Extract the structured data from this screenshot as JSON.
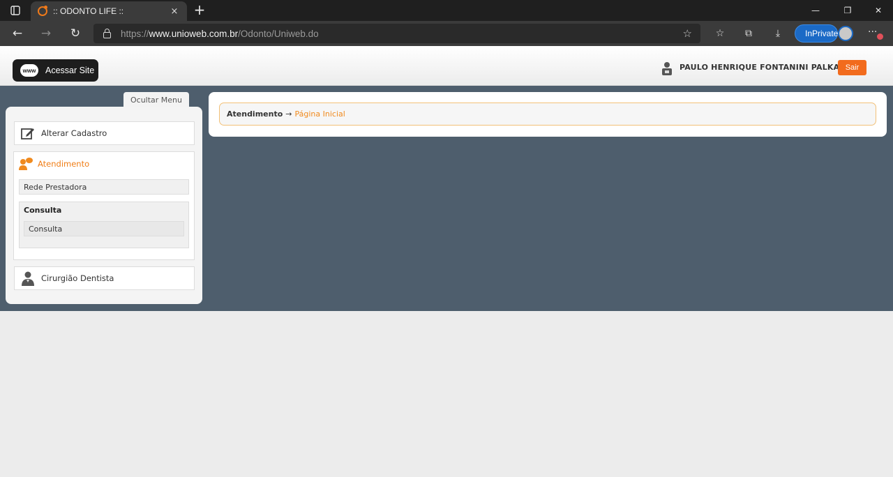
{
  "browser": {
    "tab_title": ":: ODONTO LIFE ::",
    "tab_close_glyph": "×",
    "new_tab_glyph": "+",
    "url_prefix": "https://",
    "url_host": "www.unioweb.com.br",
    "url_path": "/Odonto/Uniweb.do",
    "inprivate_label": "InPrivate",
    "window_buttons": [
      "—",
      "❐",
      "✕"
    ],
    "nav": {
      "back": "←",
      "forward": "→",
      "reload": "↻"
    },
    "more_glyph": "···"
  },
  "header": {
    "acessar_site_label": "Acessar Site",
    "www_label": "www",
    "user_name": "PAULO HENRIQUE FONTANINI PALKA",
    "logout_label": "Sair"
  },
  "sidebar": {
    "toggle_label": "Ocultar Menu",
    "alterar_cadastro": "Alterar Cadastro",
    "atendimento": "Atendimento",
    "rede_prestadora": "Rede Prestadora",
    "consulta_group_title": "Consulta",
    "consulta_item": "Consulta",
    "cirurgiao_dentista": "Cirurgião Dentista"
  },
  "breadcrumb": {
    "section": "Atendimento",
    "arrow": "→",
    "page": "Página Inicial"
  },
  "colors": {
    "accent_orange": "#f07e17",
    "content_band": "#4e5e6d",
    "inprivate_blue": "#1b6ac6"
  }
}
